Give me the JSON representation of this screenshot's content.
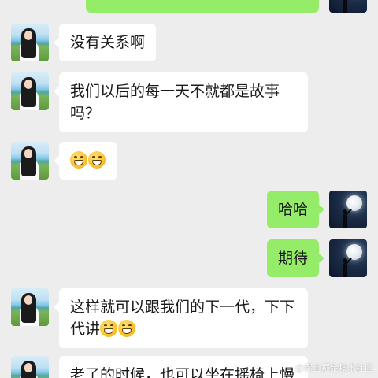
{
  "messages": [
    {
      "id": "m0",
      "side": "right",
      "avatar": "moon-avatar",
      "text": ""
    },
    {
      "id": "m1",
      "side": "left",
      "avatar": "girl-avatar",
      "text": "没有关系啊"
    },
    {
      "id": "m2",
      "side": "left",
      "avatar": "girl-avatar",
      "text": "我们以后的每一天不就都是故事吗？"
    },
    {
      "id": "m3",
      "side": "left",
      "avatar": "girl-avatar",
      "emoji": "grinning-emoji",
      "emoji_count": 2
    },
    {
      "id": "m4",
      "side": "right",
      "avatar": "moon-avatar",
      "text": "哈哈"
    },
    {
      "id": "m5",
      "side": "right",
      "avatar": "moon-avatar",
      "text": "期待"
    },
    {
      "id": "m6",
      "side": "left",
      "avatar": "girl-avatar",
      "text": "这样就可以跟我们的下一代，下下代讲",
      "emoji": "grinning-emoji",
      "emoji_count": 2
    },
    {
      "id": "m7",
      "side": "left",
      "avatar": "girl-avatar",
      "text": "老了的时候，也可以坐在摇椅上慢"
    }
  ],
  "watermark": "@稀土掘金技术社区",
  "colors": {
    "background": "#ededed",
    "incoming_bubble": "#ffffff",
    "outgoing_bubble": "#95ec69",
    "text": "#191919"
  }
}
